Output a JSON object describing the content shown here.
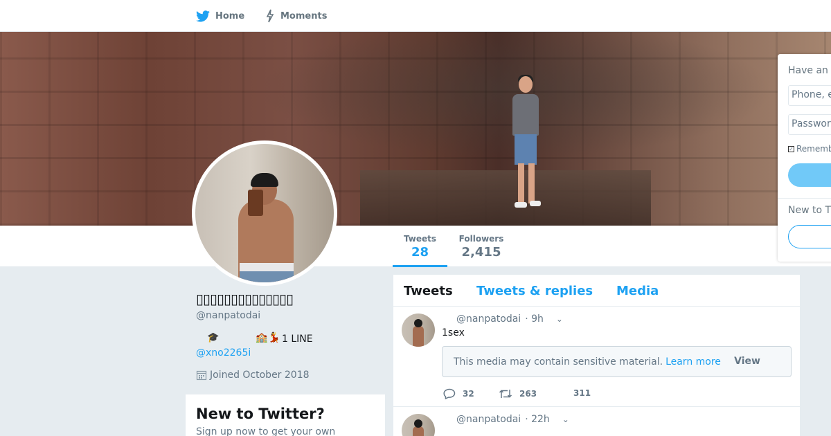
{
  "nav": {
    "home_label": "Home",
    "moments_label": "Moments"
  },
  "profile": {
    "display_name": "▯▯▯▯▯▯▯▯▯▯▯▯▯▯",
    "handle": "@nanpatodai",
    "bio_emoji_1": "🎓",
    "bio_emoji_2": "🏫",
    "bio_emoji_3": "💃",
    "bio_text": "1 LINE",
    "bio_link": "@xno2265i",
    "joined": "Joined October 2018"
  },
  "stats": {
    "tweets_label": "Tweets",
    "tweets_value": "28",
    "followers_label": "Followers",
    "followers_value": "2,415"
  },
  "signup_card": {
    "title": "New to Twitter?",
    "subtitle": "Sign up now to get your own"
  },
  "timeline": {
    "tabs": [
      {
        "label": "Tweets"
      },
      {
        "label": "Tweets & replies"
      },
      {
        "label": "Media"
      }
    ],
    "tweets": [
      {
        "handle": "@nanpatodai",
        "time": "· 9h",
        "text": "1sex",
        "sensitive_text": "This media may contain sensitive material.",
        "learn_more": "Learn more",
        "view_label": "View",
        "replies": "32",
        "retweets": "263",
        "likes": "311"
      },
      {
        "handle": "@nanpatodai",
        "time": "· 22h"
      }
    ]
  },
  "login": {
    "have_account": "Have an",
    "phone_placeholder": "Phone, e",
    "password_placeholder": "Passwor",
    "remember": "Rememb",
    "new_to": "New to T"
  },
  "colors": {
    "accent": "#1da1f2",
    "background": "#e6ecf0"
  }
}
